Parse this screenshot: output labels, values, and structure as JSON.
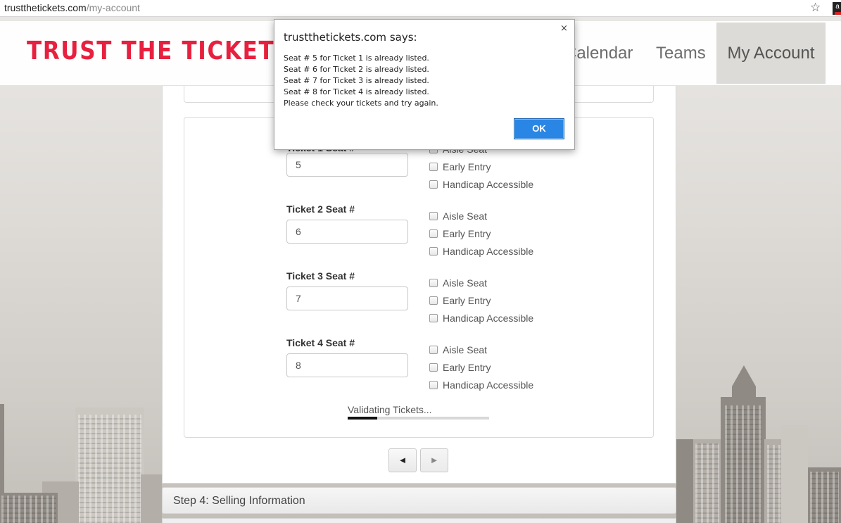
{
  "browser": {
    "url_domain": "trustthetickets.com",
    "url_path": "/my-account",
    "bookmark_icon": "star-icon",
    "extension_label": "a"
  },
  "header": {
    "logo_text": "TRUST THE TICKETS.",
    "nav": {
      "calendar": "Calendar",
      "teams": "Teams",
      "my_account": "My Account"
    }
  },
  "tickets": [
    {
      "label": "Ticket 1 Seat #",
      "seat": "5",
      "options": [
        "Aisle Seat",
        "Early Entry",
        "Handicap Accessible"
      ]
    },
    {
      "label": "Ticket 2 Seat #",
      "seat": "6",
      "options": [
        "Aisle Seat",
        "Early Entry",
        "Handicap Accessible"
      ]
    },
    {
      "label": "Ticket 3 Seat #",
      "seat": "7",
      "options": [
        "Aisle Seat",
        "Early Entry",
        "Handicap Accessible"
      ]
    },
    {
      "label": "Ticket 4 Seat #",
      "seat": "8",
      "options": [
        "Aisle Seat",
        "Early Entry",
        "Handicap Accessible"
      ]
    }
  ],
  "validation": {
    "text": "Validating Tickets...",
    "progress_fraction": 0.21
  },
  "pager": {
    "prev": "◄",
    "next": "►"
  },
  "steps": {
    "step4": "Step 4: Selling Information"
  },
  "dialog": {
    "title": "trustthetickets.com says:",
    "close": "×",
    "lines": [
      "Seat # 5 for Ticket 1 is already listed.",
      "Seat # 6 for Ticket 2 is already listed.",
      "Seat # 7 for Ticket 3 is already listed.",
      "Seat # 8 for Ticket 4 is already listed.",
      "Please check your tickets and try again."
    ],
    "ok": "OK"
  },
  "colors": {
    "brand_red": "#e8203f",
    "ok_blue": "#2a86e5"
  }
}
